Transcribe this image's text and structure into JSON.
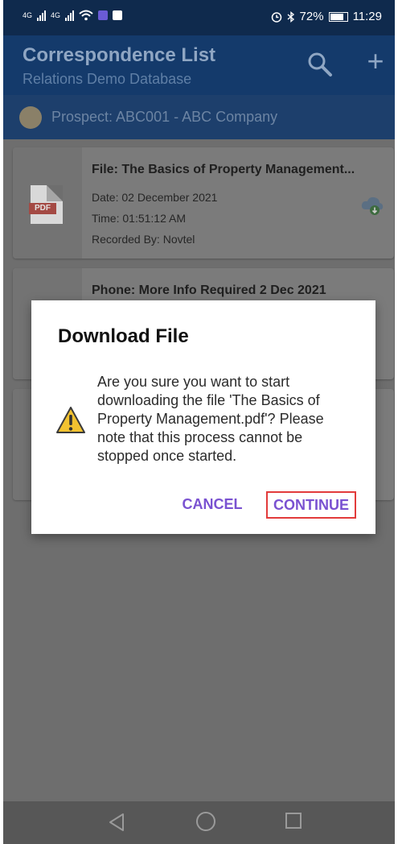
{
  "status_bar": {
    "signal1_label": "4G",
    "signal2_label": "4G",
    "battery_percent": "72%",
    "time": "11:29"
  },
  "app_bar": {
    "title": "Correspondence List",
    "subtitle": "Relations Demo Database",
    "icons": [
      "search-icon",
      "add-icon"
    ]
  },
  "prospect": {
    "text": "Prospect: ABC001 - ABC Company"
  },
  "cards": [
    {
      "title": "File: The Basics of Property Management...",
      "date": "Date: 02 December 2021",
      "time": "Time: 01:51:12 AM",
      "recorded_by": "Recorded By: Novtel",
      "file_type_label": "PDF",
      "icon": "cloud-download-icon"
    },
    {
      "title": "Phone: More Info Required 2 Dec 2021"
    }
  ],
  "dialog": {
    "title": "Download File",
    "message": "Are you sure you want to start downloading the file 'The Basics of Property Management.pdf'? Please note that this process cannot be stopped once started.",
    "cancel_label": "CANCEL",
    "continue_label": "CONTINUE",
    "icon": "warning-icon"
  },
  "nav_bar": {
    "icons": [
      "back-icon",
      "home-icon",
      "recent-apps-icon"
    ]
  },
  "colors": {
    "status_bar": "#0f2a4d",
    "app_bar": "#143a6b",
    "accent_button": "#7a52d1",
    "highlight_border": "#e23b3b",
    "pdf_red": "#d54f47"
  }
}
